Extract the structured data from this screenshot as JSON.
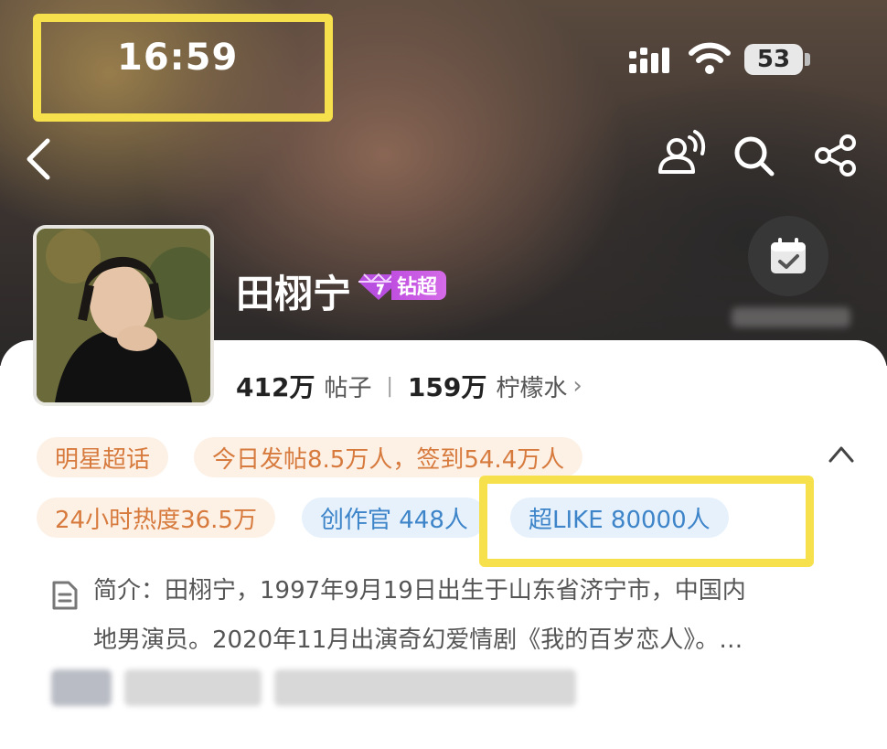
{
  "status_bar": {
    "time": "16:59",
    "battery": "53"
  },
  "header": {
    "icons": [
      "back-icon",
      "people-icon",
      "search-icon",
      "share-icon",
      "checkin-calendar-icon"
    ]
  },
  "profile": {
    "name": "田栩宁",
    "badge_label": "钻超",
    "posts_count": "412万",
    "posts_label": "帖子",
    "water_count": "159万",
    "water_label": "柠檬水",
    "water_chevron": "›"
  },
  "tags": {
    "category": "明星超话",
    "daily": "今日发帖8.5万人，签到54.4万人",
    "heat": "24小时热度36.5万",
    "creators": "创作官 448人",
    "super_like": "超LIKE 80000人"
  },
  "intro": {
    "line1": "简介：田栩宁，1997年9月19日出生于山东省济宁市，中国内",
    "line2": "地男演员。2020年11月出演奇幻爱情剧《我的百岁恋人》。…"
  },
  "colors": {
    "highlight": "#f6e14c",
    "tag_orange_bg": "#fdf1e6",
    "tag_orange_text": "#d77a3d",
    "tag_blue_bg": "#e6f1fc",
    "tag_blue_text": "#3d84c9",
    "badge_purple": "#c04fe0"
  }
}
